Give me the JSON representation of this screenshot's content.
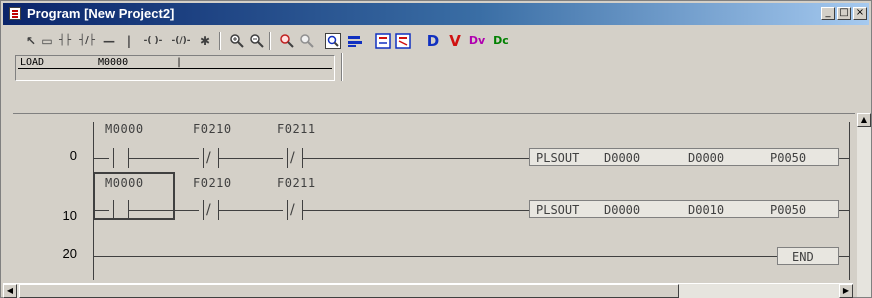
{
  "window": {
    "title": "Program [New Project2]",
    "minimize_label": "_",
    "maximize_label": "□",
    "close_label": "×"
  },
  "toolbar": {
    "colors": {
      "blue": "#1030c0",
      "red": "#d01010",
      "magenta": "#b000b0",
      "green": "#008000"
    },
    "tools": [
      {
        "name": "select-arrow-icon",
        "glyph": "↖"
      },
      {
        "name": "rectangle-icon",
        "glyph": "▭"
      },
      {
        "name": "no-contact-icon",
        "glyph": "┤├"
      },
      {
        "name": "nc-contact-icon",
        "glyph": "┤/├"
      },
      {
        "name": "horizontal-line-icon",
        "glyph": "—"
      },
      {
        "name": "vertical-line-icon",
        "glyph": "|"
      },
      {
        "name": "coil-icon",
        "glyph": "-( )-"
      },
      {
        "name": "negated-coil-icon",
        "glyph": "-(/)-"
      },
      {
        "name": "function-icon",
        "glyph": "✱"
      }
    ],
    "right_tools": [
      {
        "name": "device-d-icon",
        "glyph": "D"
      },
      {
        "name": "device-v-icon",
        "glyph": "V"
      },
      {
        "name": "device-dv-icon",
        "glyph": "Dv"
      },
      {
        "name": "device-dc-icon",
        "glyph": "Dc"
      }
    ]
  },
  "command_line": {
    "instruction": "LOAD",
    "operand": "M0000",
    "cursor": "|"
  },
  "ladder": {
    "rungs": [
      {
        "step": "0",
        "contacts": [
          {
            "device": "M0000",
            "type": "no"
          },
          {
            "device": "F0210",
            "type": "nc"
          },
          {
            "device": "F0211",
            "type": "nc"
          }
        ],
        "instruction": {
          "op": "PLSOUT",
          "args": [
            "D0000",
            "D0000",
            "P0050"
          ]
        }
      },
      {
        "step": "10",
        "contacts": [
          {
            "device": "M0000",
            "type": "no"
          },
          {
            "device": "F0210",
            "type": "nc"
          },
          {
            "device": "F0211",
            "type": "nc"
          }
        ],
        "instruction": {
          "op": "PLSOUT",
          "args": [
            "D0000",
            "D0010",
            "P0050"
          ]
        }
      },
      {
        "step": "20",
        "contacts": [],
        "instruction": {
          "op": "END",
          "args": []
        }
      }
    ]
  },
  "scrollbar": {
    "left_arrow": "◀",
    "right_arrow": "▶",
    "up_arrow": "▲"
  }
}
